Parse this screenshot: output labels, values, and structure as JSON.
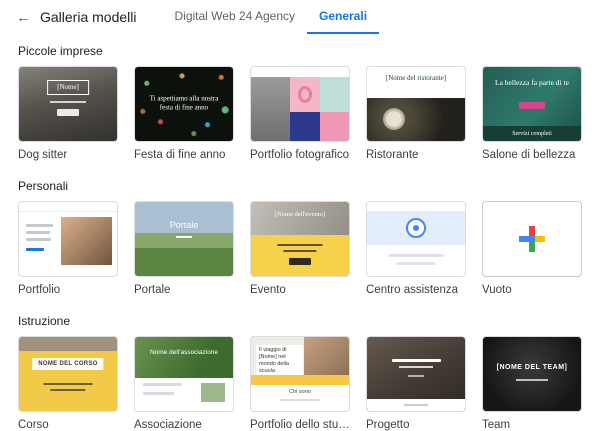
{
  "header": {
    "back_icon": "←",
    "title": "Galleria modelli",
    "tabs": [
      {
        "label": "Digital Web 24 Agency",
        "active": false
      },
      {
        "label": "Generali",
        "active": true
      }
    ]
  },
  "colors": {
    "accent": "#1a73e8",
    "google_plus": [
      "#4285f4",
      "#ea4335",
      "#fbbc04",
      "#34a853"
    ]
  },
  "sections": [
    {
      "title": "Piccole imprese",
      "templates": [
        {
          "name": "Dog sitter",
          "thumb": {
            "title": "[Nome]"
          }
        },
        {
          "name": "Festa di fine anno",
          "thumb": {
            "title": "Ti aspettiamo alla nostra festa di fine anno"
          }
        },
        {
          "name": "Portfolio fotografico",
          "thumb": {}
        },
        {
          "name": "Ristorante",
          "thumb": {
            "title": "[Nome del ristorante]"
          }
        },
        {
          "name": "Salone di bellezza",
          "thumb": {
            "title": "La bellezza fa parte di te",
            "subtitle": "Servizi completi"
          }
        }
      ]
    },
    {
      "title": "Personali",
      "templates": [
        {
          "name": "Portfolio",
          "thumb": {}
        },
        {
          "name": "Portale",
          "thumb": {
            "title": "Portale"
          }
        },
        {
          "name": "Evento",
          "thumb": {
            "title": "[Nome dell'evento]"
          }
        },
        {
          "name": "Centro assistenza",
          "thumb": {}
        },
        {
          "name": "Vuoto",
          "thumb": {}
        }
      ]
    },
    {
      "title": "Istruzione",
      "templates": [
        {
          "name": "Corso",
          "thumb": {
            "title": "NOME DEL CORSO"
          }
        },
        {
          "name": "Associazione",
          "thumb": {
            "title": "Nome dell'associazione"
          }
        },
        {
          "name": "Portfolio dello studente",
          "thumb": {
            "title": "Il viaggio di [Nome] nel mondo della scuola",
            "subtitle": "Chi sono"
          }
        },
        {
          "name": "Progetto",
          "thumb": {}
        },
        {
          "name": "Team",
          "thumb": {
            "title": "[NOME DEL TEAM]"
          }
        }
      ]
    }
  ]
}
